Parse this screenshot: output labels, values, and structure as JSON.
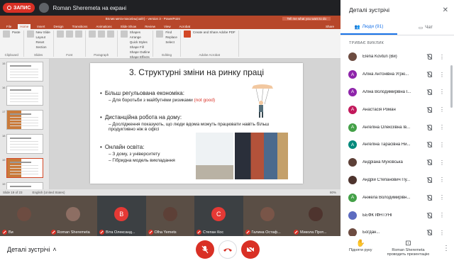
{
  "topbar": {
    "record_label": "ЗАПИС",
    "presenter_text": "Roman Sheremeta на екрані"
  },
  "powerpoint": {
    "doc_title": "Вплив мета-поколінь(сайт) - version 3 - PowerPoint",
    "tell_me": "Tell me what you want to do",
    "tabs": [
      "File",
      "Home",
      "Insert",
      "Design",
      "Transitions",
      "Animations",
      "Slide Show",
      "Review",
      "View",
      "Acrobat"
    ],
    "active_tab": "Home",
    "share_label": "Share",
    "ribbon_groups": [
      {
        "label": "Clipboard",
        "items": [
          "Paste"
        ]
      },
      {
        "label": "Slides",
        "items": [
          "New Slide",
          "Layout",
          "Reset",
          "Section"
        ]
      },
      {
        "label": "Font",
        "items": []
      },
      {
        "label": "Paragraph",
        "items": []
      },
      {
        "label": "Drawing",
        "items": [
          "Shapes",
          "Arrange",
          "Quick Styles",
          "Shape Fill",
          "Shape Outline",
          "Shape Effects"
        ]
      },
      {
        "label": "Editing",
        "items": [
          "Find",
          "Replace",
          "Select"
        ]
      },
      {
        "label": "Adobe Acrobat",
        "items": [
          "Create and Share Adobe PDF"
        ]
      }
    ],
    "thumbnails": [
      {
        "num": "15",
        "selected": false,
        "pic": false
      },
      {
        "num": "16",
        "selected": false,
        "pic": false
      },
      {
        "num": "17",
        "selected": false,
        "pic": true
      },
      {
        "num": "18",
        "selected": false,
        "pic": false
      },
      {
        "num": "19",
        "selected": true,
        "pic": true
      },
      {
        "num": "19",
        "selected": false,
        "pic": false
      }
    ],
    "slide": {
      "title": "3. Структурні зміни на ринку праці",
      "bullets": [
        {
          "main": "Більш регульована економіка:",
          "sub": [
            "Для боротьби з майбутніми ризиками"
          ],
          "highlight": "(not good)"
        },
        {
          "main": "Дистанційна робота на дому:",
          "sub": [
            "Дослідження показують, що люди вдома можуть працювати навіть більш продуктивно ніж в офісі"
          ]
        },
        {
          "main": "Онлайн освіта:",
          "sub": [
            "З дому, з університету",
            "Гібридна модель викладання"
          ]
        }
      ]
    },
    "status": {
      "slide_of": "Slide 19 of 23",
      "language": "English (United States)",
      "zoom": "80%"
    }
  },
  "tiles": [
    {
      "name": "Ви",
      "initial": "",
      "color": "#6d4c41",
      "video": true
    },
    {
      "name": "Roman Sheremeta",
      "initial": "",
      "color": "#8d6e63",
      "video": true
    },
    {
      "name": "Віта Олександ...",
      "initial": "В",
      "color": "#e53935",
      "video": false
    },
    {
      "name": "Olha Yemets",
      "initial": "",
      "color": "#5d4037",
      "video": true
    },
    {
      "name": "Степан Кос",
      "initial": "С",
      "color": "#e53935",
      "video": false
    },
    {
      "name": "Галина Остаф...",
      "initial": "",
      "color": "#795548",
      "video": true
    },
    {
      "name": "Микола Прот...",
      "initial": "",
      "color": "#4e342e",
      "video": true
    }
  ],
  "bottombar": {
    "meet_details": "Деталі зустрічі",
    "raise_hand": "Підняти руку",
    "presenting": "Roman Sheremeta проводить презентацію"
  },
  "side": {
    "title": "Деталі зустрічі",
    "tab_people": "Люди (91)",
    "tab_chat": "Чат",
    "section": "ТРИВАЄ ВИКЛИК",
    "participants": [
      {
        "name": "Elena Kovtun (Ви)",
        "initial": "",
        "color": "#6d4c41"
      },
      {
        "name": "Аліна Антонівна Угрю...",
        "initial": "А",
        "color": "#8e24aa"
      },
      {
        "name": "Аліна Володимирівна І...",
        "initial": "А",
        "color": "#8e24aa"
      },
      {
        "name": "Анастасія Роман",
        "initial": "А",
        "color": "#c2185b"
      },
      {
        "name": "Ангеліна Олексіївна Ів...",
        "initial": "А",
        "color": "#43a047"
      },
      {
        "name": "Ангеліна Тарасівна Ни...",
        "initial": "А",
        "color": "#00897b"
      },
      {
        "name": "Андріана Муховська",
        "initial": "",
        "color": "#5d4037"
      },
      {
        "name": "Андрій Степанович Пу...",
        "initial": "",
        "color": "#4e342e"
      },
      {
        "name": "Анжела Володимирівн...",
        "initial": "А",
        "color": "#43a047"
      },
      {
        "name": "БЕФК ІФНТУНГ",
        "initial": "",
        "color": "#5c6bc0"
      },
      {
        "name": "Богдан...",
        "initial": "",
        "color": "#6d4c41"
      }
    ]
  }
}
